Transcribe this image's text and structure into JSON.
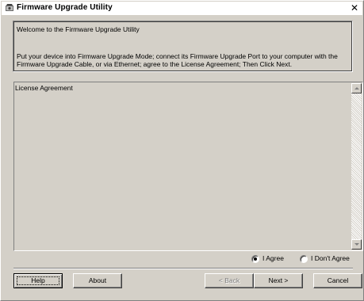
{
  "window": {
    "title": "Firmware Upgrade Utility",
    "close_glyph": "✕"
  },
  "welcome": {
    "title": "Welcome to the Firmware Upgrade Utility",
    "instructions": "Put your device into Firmware Upgrade Mode; connect its Firmware Upgrade Port to your computer with the Firmware Upgrade Cable, or via Ethernet; agree to the License Agreement; Then Click Next."
  },
  "license": {
    "text": "License Agreement"
  },
  "agreement": {
    "agree_label": "I Agree",
    "disagree_label": "I Don't Agree",
    "selected": "agree"
  },
  "buttons": {
    "help": "Help",
    "about": "About",
    "back": "< Back",
    "next": "Next >",
    "cancel": "Cancel"
  }
}
